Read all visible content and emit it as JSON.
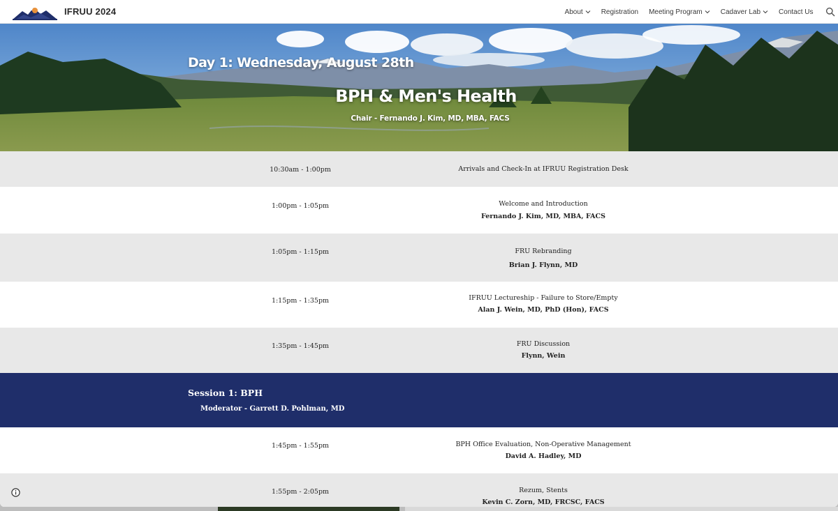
{
  "header": {
    "site_title": "IFRUU 2024",
    "nav": [
      {
        "label": "About",
        "dropdown": true
      },
      {
        "label": "Registration",
        "dropdown": false
      },
      {
        "label": "Meeting Program",
        "dropdown": true
      },
      {
        "label": "Cadaver Lab",
        "dropdown": true
      },
      {
        "label": "Contact Us",
        "dropdown": false
      }
    ],
    "search_icon": "search-icon"
  },
  "banner": {
    "day": "Day 1: Wednesday, August 28th",
    "title": "BPH & Men's Health",
    "chair": "Chair - Fernando J. Kim, MD, MBA, FACS"
  },
  "schedule": [
    {
      "time": "10:30am - 1:00pm",
      "title": "Arrivals and Check-In at IFRUU Registration Desk",
      "speaker": ""
    },
    {
      "time": "1:00pm - 1:05pm",
      "title": "Welcome and Introduction",
      "speaker": "Fernando J. Kim, MD, MBA, FACS"
    },
    {
      "time": "1:05pm - 1:15pm",
      "title": "FRU Rebranding",
      "speaker": "Brian J. Flynn, MD"
    },
    {
      "time": "1:15pm - 1:35pm",
      "title": "IFRUU Lectureship - Failure to Store/Empty",
      "speaker": "Alan J. Wein, MD, PhD (Hon), FACS"
    },
    {
      "time": "1:35pm - 1:45pm",
      "title": "FRU Discussion",
      "speaker": "Flynn, Wein"
    }
  ],
  "session": {
    "title": "Session 1: BPH",
    "moderator": "Moderator - Garrett D. Pohlman, MD"
  },
  "schedule2": [
    {
      "time": "1:45pm - 1:55pm",
      "title": "BPH Office Evaluation, Non-Operative Management",
      "speaker": "David A. Hadley, MD"
    },
    {
      "time": "1:55pm - 2:05pm",
      "title": "Rezum, Stents",
      "speaker": "Kevin C. Zorn, MD, FRCSC, FACS"
    }
  ],
  "colors": {
    "session_band": "#1f2e6a",
    "row_gray": "#e8e8e8",
    "row_white": "#ffffff"
  },
  "info_icon": "info-icon"
}
